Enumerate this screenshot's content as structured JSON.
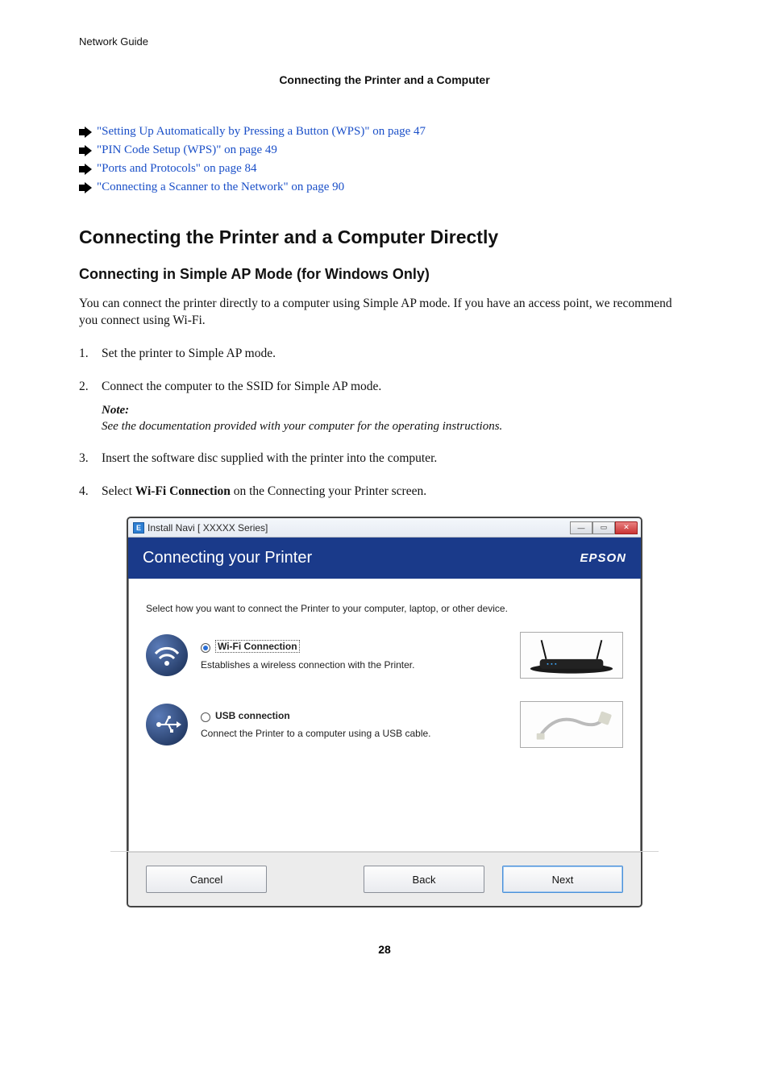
{
  "running_head": "Network Guide",
  "section_title": "Connecting the Printer and a Computer",
  "links": [
    "\"Setting Up Automatically by Pressing a Button (WPS)\" on page 47",
    "\"PIN Code Setup (WPS)\" on page 49",
    "\"Ports and Protocols\" on page 84",
    "\"Connecting a Scanner to the Network\" on page 90"
  ],
  "h2": "Connecting the Printer and a Computer Directly",
  "h3": "Connecting in Simple AP Mode (for Windows Only)",
  "intro": "You can connect the printer directly to a computer using Simple AP mode. If you have an access point, we recommend you connect using Wi-Fi.",
  "steps": {
    "s1": "Set the printer to Simple AP mode.",
    "s2": "Connect the computer to the SSID for Simple AP mode.",
    "note_head": "Note:",
    "note_body": "See the documentation provided with your computer for the operating instructions.",
    "s3": "Insert the software disc supplied with the printer into the computer.",
    "s4_pre": "Select ",
    "s4_bold": "Wi-Fi Connection",
    "s4_post": " on the Connecting your Printer screen."
  },
  "dialog": {
    "window_title": "Install Navi [   XXXXX   Series]",
    "header_title": "Connecting your Printer",
    "brand": "EPSON",
    "instruction": "Select how you want to connect the Printer to your computer, laptop, or other device.",
    "opt1": {
      "title": "Wi-Fi Connection",
      "desc": "Establishes a wireless connection with the Printer."
    },
    "opt2": {
      "title": "USB connection",
      "desc": "Connect the Printer to a computer using a USB cable."
    },
    "buttons": {
      "cancel": "Cancel",
      "back": "Back",
      "next": "Next"
    }
  },
  "page_number": "28"
}
